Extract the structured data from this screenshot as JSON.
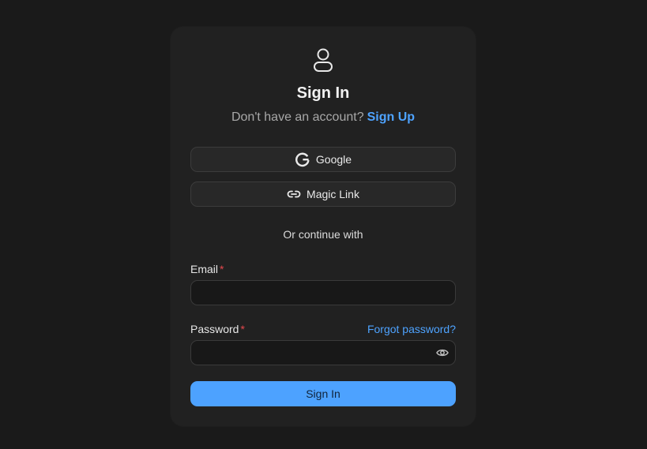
{
  "header": {
    "icon": "user-icon",
    "title": "Sign In",
    "subtitle_text": "Don't have an account?",
    "signup_link": "Sign Up"
  },
  "oauth": {
    "google_label": "Google",
    "google_icon": "google-icon",
    "magic_label": "Magic Link",
    "magic_icon": "link-icon"
  },
  "divider_text": "Or continue with",
  "form": {
    "email_label": "Email",
    "email_value": "",
    "password_label": "Password",
    "password_value": "",
    "required_marker": "*",
    "forgot_link": "Forgot password?",
    "submit_label": "Sign In"
  },
  "colors": {
    "background": "#1a1a1a",
    "card": "#212121",
    "accent": "#4da2ff",
    "required": "#e5484d"
  }
}
